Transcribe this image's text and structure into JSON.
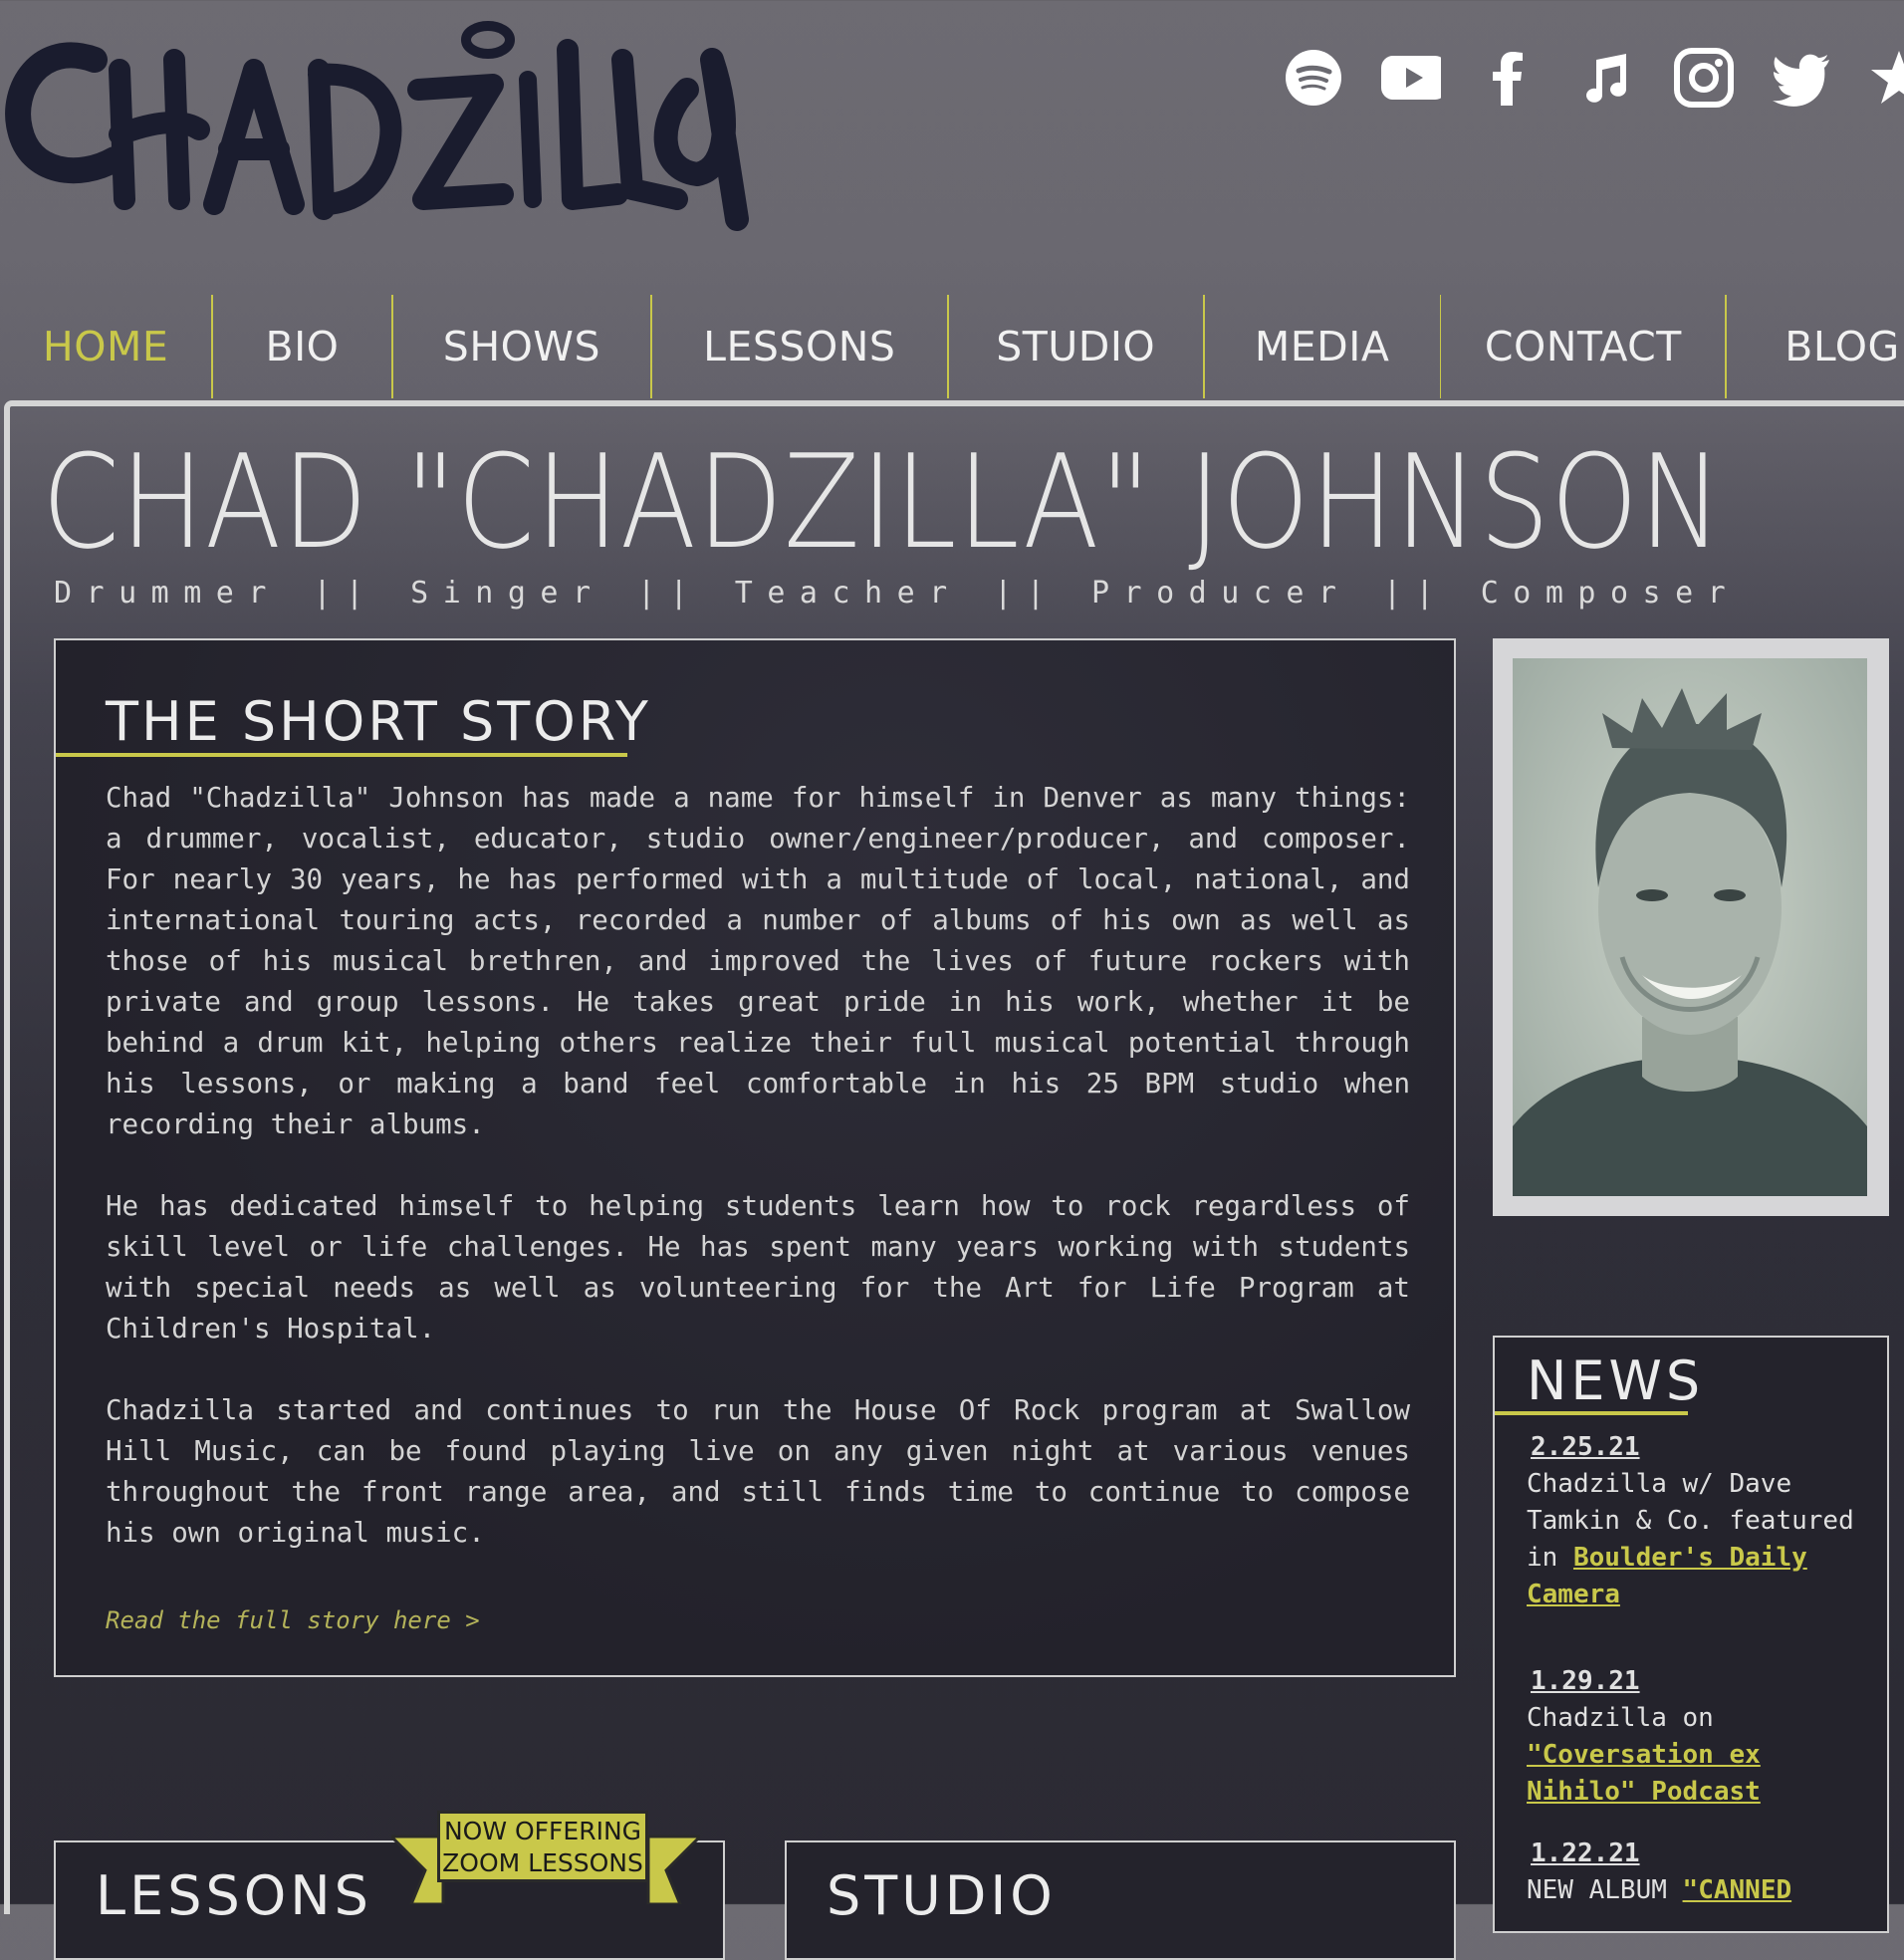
{
  "logo_text": "CHADZILLA",
  "social": [
    "spotify-icon",
    "youtube-icon",
    "facebook-icon",
    "music-note-icon",
    "instagram-icon",
    "twitter-icon",
    "star-icon"
  ],
  "nav": [
    "HOME",
    "BIO",
    "SHOWS",
    "LESSONS",
    "STUDIO",
    "MEDIA",
    "CONTACT",
    "BLOG"
  ],
  "nav_active": "HOME",
  "title": "CHAD \"CHADZILLA\" JOHNSON",
  "subtitle": "Drummer || Singer || Teacher || Producer || Composer",
  "story": {
    "heading": "THE SHORT STORY",
    "paragraphs": [
      "Chad \"Chadzilla\" Johnson has made a name for himself in Denver as many things: a drummer, vocalist, educator, studio owner/engineer/producer, and composer. For nearly 30 years, he has performed with a multitude of local, national, and international touring acts, recorded a number of albums of his own as well as those of his musical brethren, and improved the lives of future rockers with private and group lessons. He takes great pride in his work, whether it be behind a drum kit, helping others realize their full musical potential through his lessons, or making a band feel comfortable in his 25 BPM studio when recording their albums.",
      "He has dedicated himself to helping students learn how to rock regardless of skill level or life challenges. He has spent many years working with students with special needs as well as volunteering for the Art for Life Program at Children's Hospital.",
      "Chadzilla started and continues to run the House Of Rock program at Swallow Hill Music, can be found playing live on any given night at various venues throughout the front range area, and still finds time to continue to compose his own original music."
    ],
    "link": "Read the full story here >"
  },
  "news": {
    "heading": "NEWS",
    "items": [
      {
        "date": "2.25.21",
        "text": "Chadzilla w/ Dave Tamkin & Co. featured in ",
        "link": "Boulder's Daily Camera"
      },
      {
        "date": "1.29.21",
        "text": "Chadzilla on ",
        "link": "\"Coversation ex Nihilo\" Podcast"
      },
      {
        "date": "1.22.21",
        "text": "NEW ALBUM ",
        "link": "\"CANNED"
      }
    ]
  },
  "lessons": {
    "heading": "LESSONS",
    "banner_line1": "NOW OFFERING",
    "banner_line2": "ZOOM LESSONS"
  },
  "studio": {
    "heading": "STUDIO"
  },
  "colors": {
    "accent": "#c9c84a",
    "panel": "#24232c",
    "logo": "#1a1c2e"
  }
}
